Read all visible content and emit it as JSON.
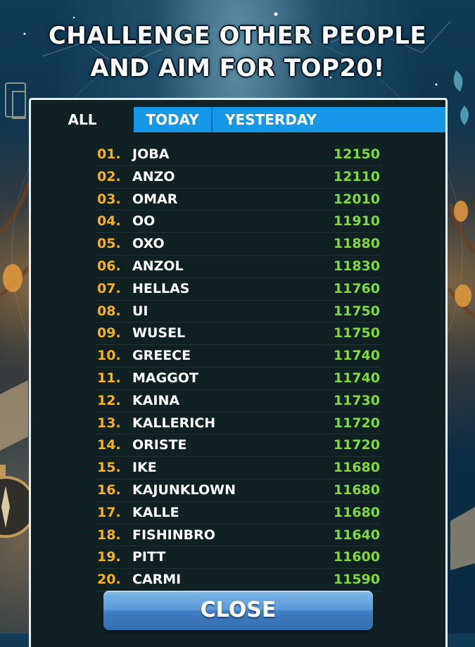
{
  "headline": {
    "line1": "CHALLENGE OTHER PEOPLE",
    "line2": "AND AIM FOR TOP20!"
  },
  "tabs": {
    "all": "ALL",
    "today": "TODAY",
    "yesterday": "YESTERDAY",
    "active": "all"
  },
  "leaderboard": [
    {
      "rank": "01.",
      "name": "JOBA",
      "score": "12150"
    },
    {
      "rank": "02.",
      "name": "ANZO",
      "score": "12110"
    },
    {
      "rank": "03.",
      "name": "OMAR",
      "score": "12010"
    },
    {
      "rank": "04.",
      "name": "OO",
      "score": "11910"
    },
    {
      "rank": "05.",
      "name": "OXO",
      "score": "11880"
    },
    {
      "rank": "06.",
      "name": "ANZOL",
      "score": "11830"
    },
    {
      "rank": "07.",
      "name": "HELLAS",
      "score": "11760"
    },
    {
      "rank": "08.",
      "name": "UI",
      "score": "11750"
    },
    {
      "rank": "09.",
      "name": "WUSEL",
      "score": "11750"
    },
    {
      "rank": "10.",
      "name": "GREECE",
      "score": "11740"
    },
    {
      "rank": "11.",
      "name": "MAGGOT",
      "score": "11740"
    },
    {
      "rank": "12.",
      "name": "KAINA",
      "score": "11730"
    },
    {
      "rank": "13.",
      "name": "KALLERICH",
      "score": "11720"
    },
    {
      "rank": "14.",
      "name": "ORISTE",
      "score": "11720"
    },
    {
      "rank": "15.",
      "name": "IKE",
      "score": "11680"
    },
    {
      "rank": "16.",
      "name": "KAJUNKLOWN",
      "score": "11680"
    },
    {
      "rank": "17.",
      "name": "KALLE",
      "score": "11680"
    },
    {
      "rank": "18.",
      "name": "FISHINBRO",
      "score": "11640"
    },
    {
      "rank": "19.",
      "name": "PITT",
      "score": "11600"
    },
    {
      "rank": "20.",
      "name": "CARMI",
      "score": "11590"
    }
  ],
  "close_button": "CLOSE",
  "colors": {
    "rank": "#f5b31b",
    "name": "#ffffff",
    "score": "#7fd93a",
    "tab_active_bg": "#102023",
    "tab_inactive_bg": "#1697e8",
    "panel_bg": "#102023"
  }
}
